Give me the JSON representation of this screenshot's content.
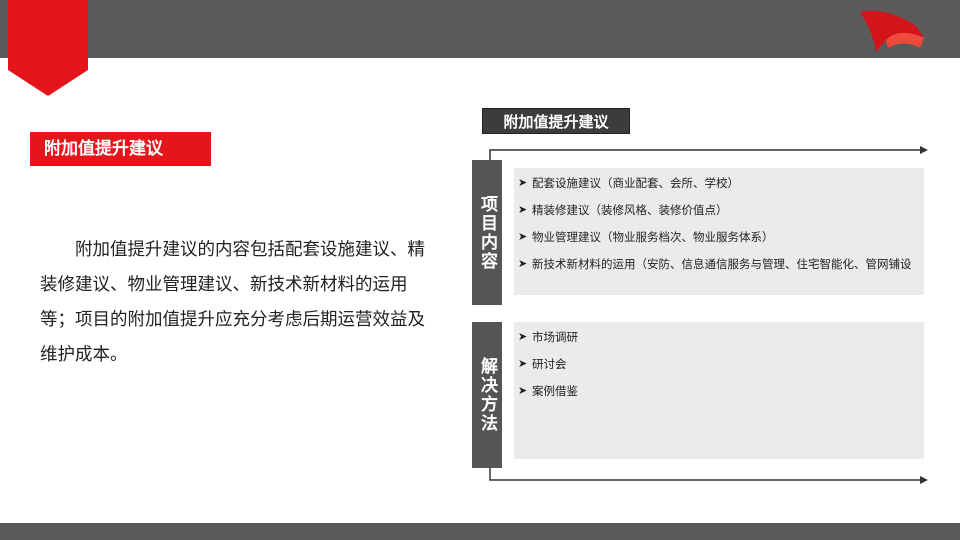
{
  "section": {
    "label": "附加值提升建议"
  },
  "body": {
    "paragraph": "附加值提升建议的内容包括配套设施建议、精装修建议、物业管理建议、新技术新材料的运用等；项目的附加值提升应充分考虑后期运营效益及维护成本。"
  },
  "panel": {
    "title": "附加值提升建议",
    "groups": [
      {
        "label": "项目内容",
        "items": [
          "配套设施建议（商业配套、会所、学校）",
          "精装修建议（装修风格、装修价值点）",
          "物业管理建议（物业服务档次、物业服务体系）",
          "新技术新材料的运用（安防、信息通信服务与管理、住宅智能化、管网铺设"
        ]
      },
      {
        "label": "解决方法",
        "items": [
          "市场调研",
          "研讨会",
          "案例借鉴"
        ]
      }
    ]
  },
  "colors": {
    "accent_red": "#e4161c",
    "bar_gray": "#5a5a5a",
    "side_box_gray": "#555555",
    "content_box_gray": "#ebebeb"
  },
  "icons": {
    "bullet": "chevron-right-icon",
    "logo": "red-flag-logo"
  }
}
